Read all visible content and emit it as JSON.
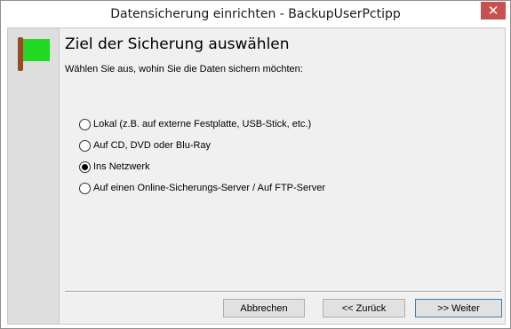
{
  "window": {
    "title": "Datensicherung einrichten - BackupUserPctipp",
    "close_label": "✕"
  },
  "page": {
    "heading": "Ziel der Sicherung auswählen",
    "subtitle": "Wählen Sie aus, wohin Sie die Daten sichern möchten:"
  },
  "options": [
    {
      "label": "Lokal (z.B. auf externe Festplatte, USB-Stick, etc.)",
      "checked": false
    },
    {
      "label": "Auf CD, DVD oder Blu-Ray",
      "checked": false
    },
    {
      "label": "Ins Netzwerk",
      "checked": true
    },
    {
      "label": "Auf einen Online-Sicherungs-Server / Auf FTP-Server",
      "checked": false
    }
  ],
  "buttons": {
    "cancel": "Abbrechen",
    "back": "<< Zurück",
    "next": ">> Weiter"
  },
  "colors": {
    "flag": "#22d822",
    "flag_pole": "#9a4a1e",
    "close": "#c75050",
    "strip": "#dedede"
  }
}
